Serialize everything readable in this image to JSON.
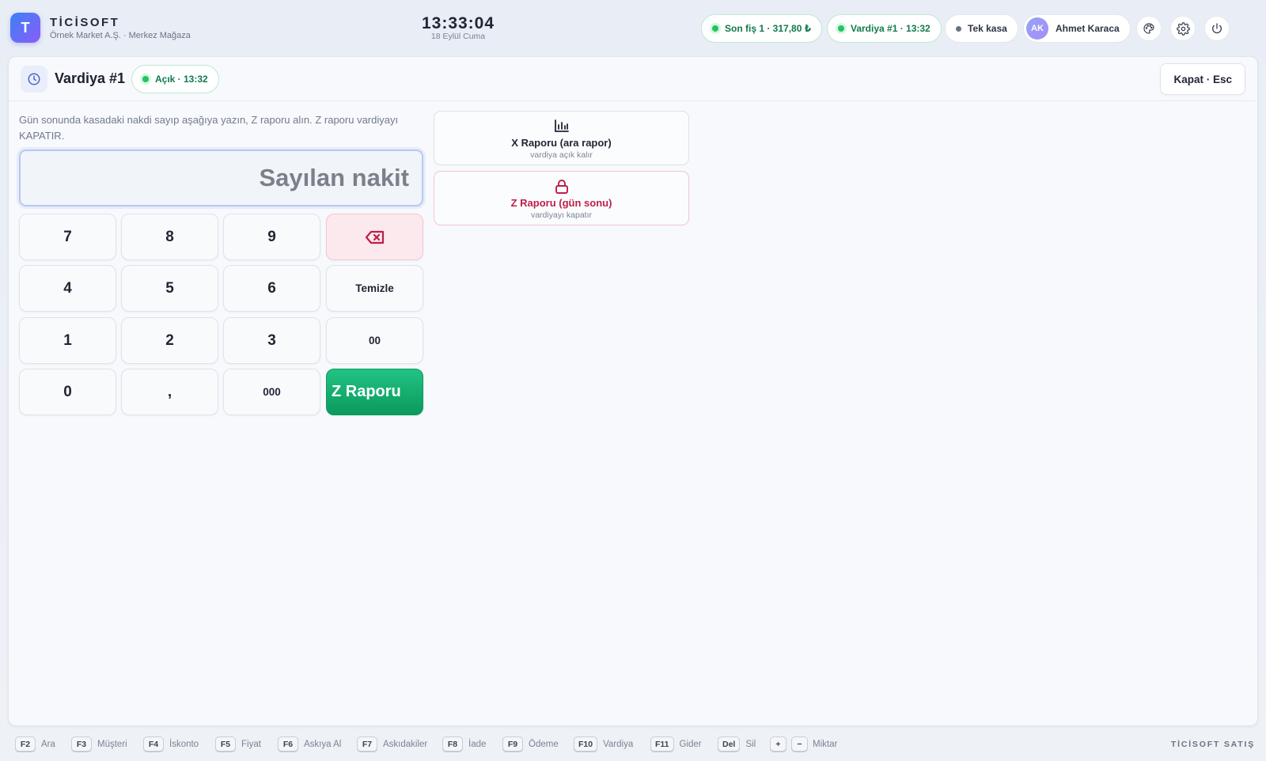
{
  "header": {
    "logo_letter": "T",
    "brand": "TİCİSOFT",
    "company": "Örnek Market A.Ş. · Merkez Mağaza",
    "time": "13:33:04",
    "date": "18 Eylül Cuma",
    "last_receipt": "Son fiş 1 · 317,80 ₺",
    "shift": "Vardiya #1 · 13:32",
    "register": "Tek kasa",
    "user_initials": "AK",
    "user_name": "Ahmet Karaca",
    "icons": [
      "palette-icon",
      "gear-icon",
      "power-icon"
    ]
  },
  "panel": {
    "title": "Vardiya #1",
    "status": "Açık · 13:32",
    "close_label": "Kapat · Esc",
    "instruction": "Gün sonunda kasadaki nakdi sayıp aşağıya yazın, Z raporu alın. Z raporu vardiyayı KAPATIR.",
    "cash_placeholder": "Sayılan nakit",
    "cash_value": ""
  },
  "keypad": {
    "k7": "7",
    "k8": "8",
    "k9": "9",
    "k4": "4",
    "k5": "5",
    "k6": "6",
    "k1": "1",
    "k2": "2",
    "k3": "3",
    "k0": "0",
    "comma": ",",
    "k000": "000",
    "k00": "00",
    "clear": "Temizle",
    "backspace_icon": "backspace-icon",
    "z_report": "Z Raporu"
  },
  "reports": {
    "x": {
      "label": "X Raporu (ara rapor)",
      "sub": "vardiya açık kalır",
      "icon": "bar-chart-icon"
    },
    "z": {
      "label": "Z Raporu (gün sonu)",
      "sub": "vardiyayı kapatır",
      "icon": "lock-icon"
    }
  },
  "footer": {
    "shortcuts": [
      {
        "key": "F2",
        "label": "Ara"
      },
      {
        "key": "F3",
        "label": "Müşteri"
      },
      {
        "key": "F4",
        "label": "İskonto"
      },
      {
        "key": "F5",
        "label": "Fiyat"
      },
      {
        "key": "F6",
        "label": "Askıya Al"
      },
      {
        "key": "F7",
        "label": "Askıdakiler"
      },
      {
        "key": "F8",
        "label": "İade"
      },
      {
        "key": "F9",
        "label": "Ödeme"
      },
      {
        "key": "F10",
        "label": "Vardiya"
      },
      {
        "key": "F11",
        "label": "Gider"
      },
      {
        "key": "Del",
        "label": "Sil"
      }
    ],
    "qty_plus": "+",
    "qty_minus": "−",
    "qty_label": "Miktar",
    "brand": "TİCİSOFT SATIŞ"
  },
  "colors": {
    "accent_green": "#0b9a5c",
    "danger": "#be1e4b",
    "focus_blue": "#b6c8f3"
  }
}
